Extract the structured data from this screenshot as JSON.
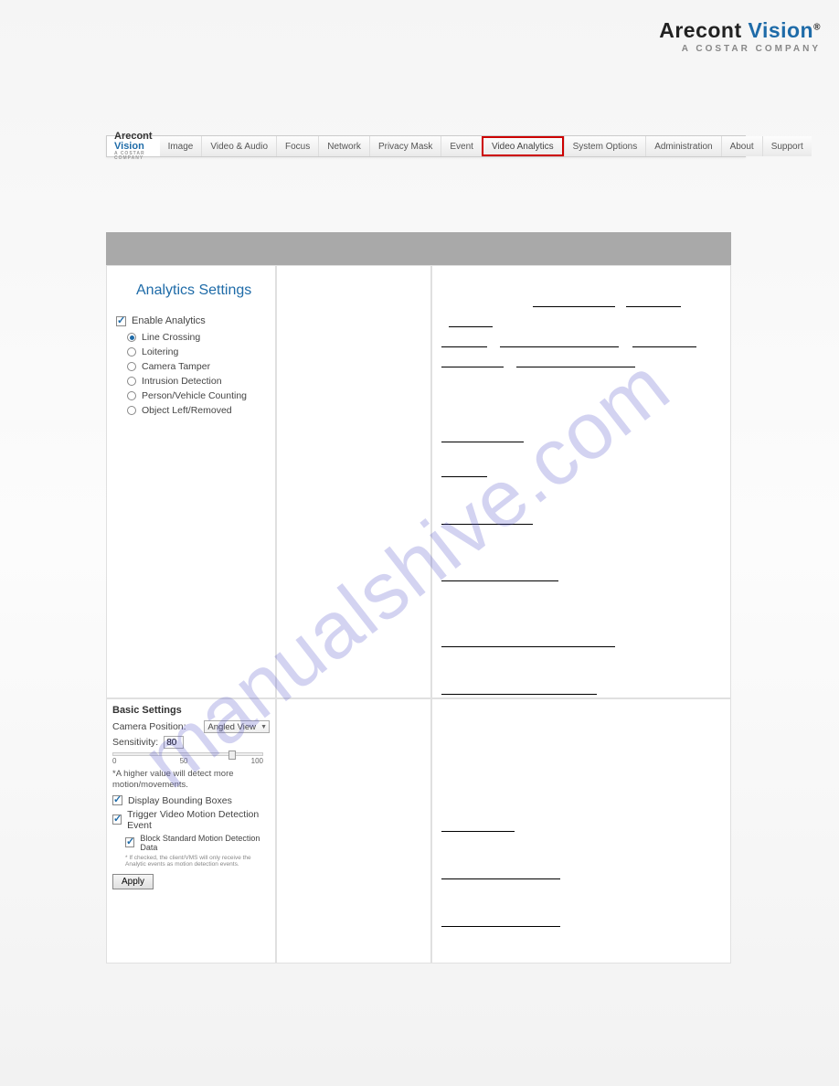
{
  "brand": {
    "part1": "Arecont ",
    "part2": "Vision",
    "sub": "A COSTAR COMPANY"
  },
  "navbar": {
    "tabs": [
      "Image",
      "Video & Audio",
      "Focus",
      "Network",
      "Privacy Mask",
      "Event",
      "Video Analytics",
      "System Options",
      "Administration",
      "About",
      "Support"
    ],
    "active_index": 6
  },
  "analytics": {
    "title": "Analytics Settings",
    "enable_label": "Enable Analytics",
    "enable_checked": true,
    "options": [
      {
        "label": "Line Crossing",
        "selected": true
      },
      {
        "label": "Loitering",
        "selected": false
      },
      {
        "label": "Camera Tamper",
        "selected": false
      },
      {
        "label": "Intrusion Detection",
        "selected": false
      },
      {
        "label": "Person/Vehicle Counting",
        "selected": false
      },
      {
        "label": "Object Left/Removed",
        "selected": false
      }
    ]
  },
  "basic": {
    "heading": "Basic Settings",
    "camera_position_label": "Camera Position:",
    "camera_position_value": "Angled View",
    "sensitivity_label": "Sensitivity:",
    "sensitivity_value": "80",
    "slider": {
      "min": "0",
      "mid": "50",
      "max": "100",
      "value_percent": 80
    },
    "note": "*A higher value will detect more motion/movements.",
    "display_boxes_label": "Display Bounding Boxes",
    "display_boxes_checked": true,
    "trigger_label": "Trigger Video Motion Detection Event",
    "trigger_checked": true,
    "block_md_label": "Block Standard Motion Detection Data",
    "block_md_checked": true,
    "block_md_note": "* If checked, the client/VMS will only receive the Analytic events as motion detection events.",
    "apply": "Apply"
  },
  "watermark": "manualshive.com"
}
